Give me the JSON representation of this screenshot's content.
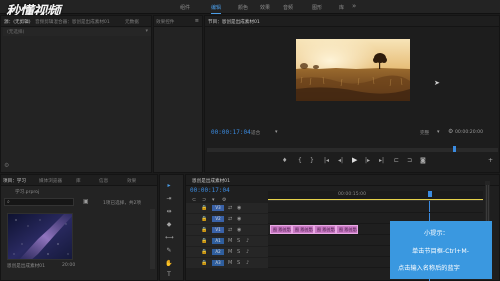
{
  "logo": {
    "text": "秒懂视频"
  },
  "menu": {
    "items": [
      {
        "label": "组件",
        "active": false
      },
      {
        "label": "编辑",
        "active": true
      },
      {
        "label": "颜色",
        "active": false
      },
      {
        "label": "效果",
        "active": false
      },
      {
        "label": "音频",
        "active": false
      },
      {
        "label": "图形",
        "active": false
      },
      {
        "label": "库",
        "active": false
      }
    ]
  },
  "source_panel": {
    "tabs": [
      "源：(无剪辑)",
      "音频剪辑混合器：恩创是出成素材01",
      "元数据"
    ],
    "dropdown": "(无选择)"
  },
  "effects_panel": {
    "tab": "效果控件"
  },
  "program_panel": {
    "tab": "节目：恩创是出成素材01",
    "timecode_left": "00:00:17:04",
    "fit": "适合",
    "quality": "完整",
    "timecode_right": "00:00:20:00"
  },
  "project_panel": {
    "tabs": [
      "项目：学习",
      "媒体浏览器",
      "库",
      "信息",
      "效果"
    ],
    "project_name": "学习.prproj",
    "selection": "1项已选择，共2项",
    "item_name": "恩创是出成素材01",
    "item_duration": "20:00"
  },
  "timeline_panel": {
    "tab": "恩创是出成素材01",
    "timecode": "00:00:17:04",
    "ruler_mark": "00:00:15:00",
    "tracks": [
      "V3",
      "V2",
      "V1",
      "A1",
      "A2",
      "A3"
    ],
    "clip_label": "图 恩创是出成素材01"
  },
  "tip": {
    "title": "小提示：",
    "lines": [
      "单击节目框-Ctrl+M-",
      "点击输入名称后的蓝字"
    ]
  },
  "colors": {
    "accent": "#4a9de8",
    "timecode": "#3b8be0",
    "clip": "#c979c4",
    "tip_bg": "#3a98e0"
  }
}
